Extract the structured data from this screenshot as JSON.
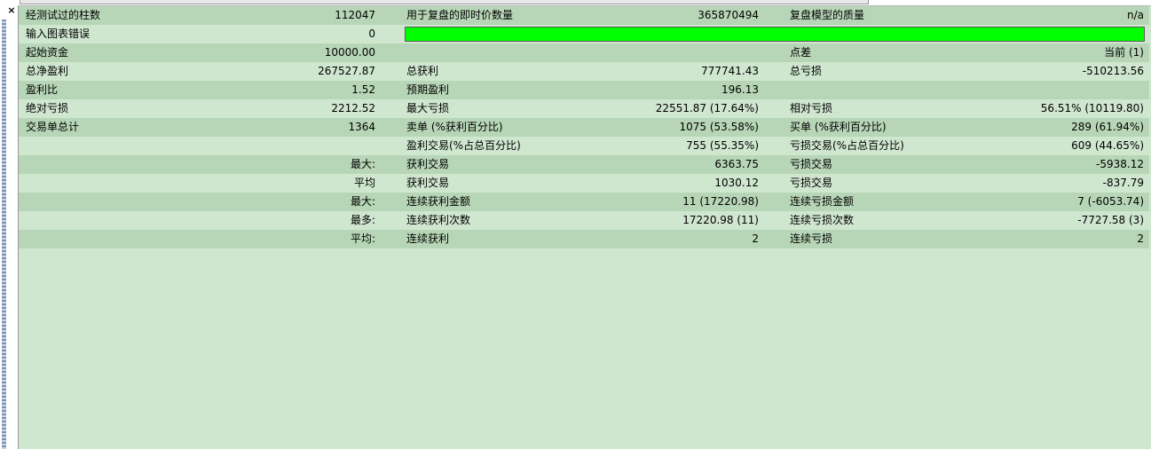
{
  "window": {
    "close_glyph": "×"
  },
  "rows": [
    {
      "l1": "经测试过的柱数",
      "v1": "112047",
      "l2": "用于复盘的即时价数量",
      "v2": "365870494",
      "l3": "复盘模型的质量",
      "v3": "n/a"
    },
    {
      "l1": "输入图表错误",
      "v1": "0",
      "l2": "",
      "v2": "",
      "l3": "",
      "v3": ""
    },
    {
      "l1": "起始资金",
      "v1": "10000.00",
      "l2": "",
      "v2": "",
      "l3": "点差",
      "v3": "当前 (1)"
    },
    {
      "l1": "总净盈利",
      "v1": "267527.87",
      "l2": "总获利",
      "v2": "777741.43",
      "l3": "总亏损",
      "v3": "-510213.56"
    },
    {
      "l1": "盈利比",
      "v1": "1.52",
      "l2": "预期盈利",
      "v2": "196.13",
      "l3": "",
      "v3": ""
    },
    {
      "l1": "绝对亏损",
      "v1": "2212.52",
      "l2": "最大亏损",
      "v2": "22551.87 (17.64%)",
      "l3": "相对亏损",
      "v3": "56.51% (10119.80)"
    },
    {
      "l1": "交易单总计",
      "v1": "1364",
      "l2": "卖单 (%获利百分比)",
      "v2": "1075 (53.58%)",
      "l3": "买单 (%获利百分比)",
      "v3": "289 (61.94%)"
    },
    {
      "l1": "",
      "v1": "",
      "l2": "盈利交易(%占总百分比)",
      "v2": "755 (55.35%)",
      "l3": "亏损交易(%占总百分比)",
      "v3": "609 (44.65%)"
    },
    {
      "l1": "",
      "v1": "最大:",
      "l2": "获利交易",
      "v2": "6363.75",
      "l3": "亏损交易",
      "v3": "-5938.12"
    },
    {
      "l1": "",
      "v1": "平均",
      "l2": "获利交易",
      "v2": "1030.12",
      "l3": "亏损交易",
      "v3": "-837.79"
    },
    {
      "l1": "",
      "v1": "最大:",
      "l2": "连续获利金额",
      "v2": "11 (17220.98)",
      "l3": "连续亏损金额",
      "v3": "7 (-6053.74)"
    },
    {
      "l1": "",
      "v1": "最多:",
      "l2": "连续获利次数",
      "v2": "17220.98 (11)",
      "l3": "连续亏损次数",
      "v3": "-7727.58 (3)"
    },
    {
      "l1": "",
      "v1": "平均:",
      "l2": "连续获利",
      "v2": "2",
      "l3": "连续亏损",
      "v3": "2"
    }
  ],
  "quality_bar": {
    "fill_color": "#00ff00"
  }
}
